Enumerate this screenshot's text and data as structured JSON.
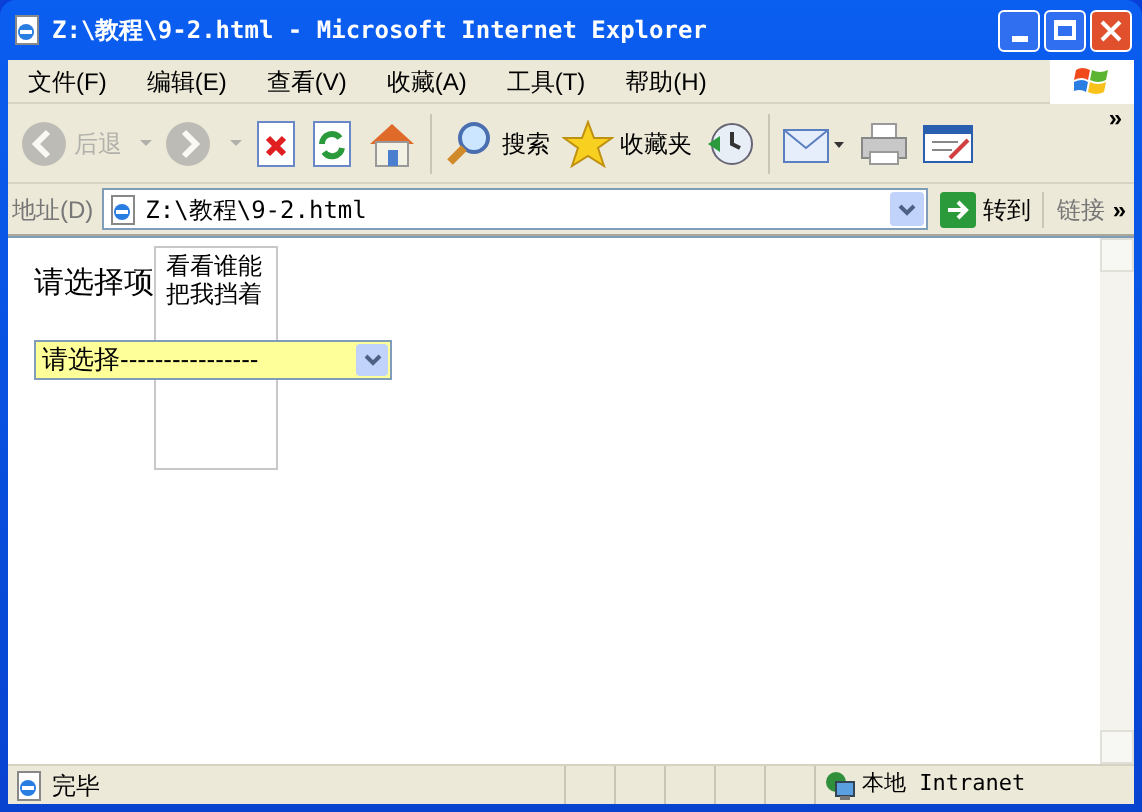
{
  "window": {
    "title": "Z:\\教程\\9-2.html - Microsoft Internet Explorer"
  },
  "menu": [
    "文件(F)",
    "编辑(E)",
    "查看(V)",
    "收藏(A)",
    "工具(T)",
    "帮助(H)"
  ],
  "toolbar": [
    {
      "kind": "back",
      "label": "后退",
      "disabled": true
    },
    {
      "kind": "forward",
      "disabled": true
    },
    {
      "kind": "stop",
      "disabled": false
    },
    {
      "kind": "refresh",
      "disabled": false
    },
    {
      "kind": "home",
      "disabled": false
    },
    {
      "kind": "search",
      "label": "搜索",
      "disabled": false
    },
    {
      "kind": "favorites",
      "label": "收藏夹",
      "disabled": false
    },
    {
      "kind": "history",
      "disabled": false
    },
    {
      "kind": "mail",
      "disabled": false
    },
    {
      "kind": "print",
      "disabled": false
    },
    {
      "kind": "edit",
      "disabled": false
    }
  ],
  "toolbar_more": "»",
  "address": {
    "label": "地址(D)",
    "value": "Z:\\教程\\9-2.html",
    "go": "转到",
    "links": "链接",
    "links_more": "»"
  },
  "page": {
    "label": "请选择项",
    "overlay_text": "看看谁能把我挡着",
    "select_value": "请选择----------------"
  },
  "status_bar": {
    "text": "完毕",
    "zone": "本地 Intranet"
  }
}
